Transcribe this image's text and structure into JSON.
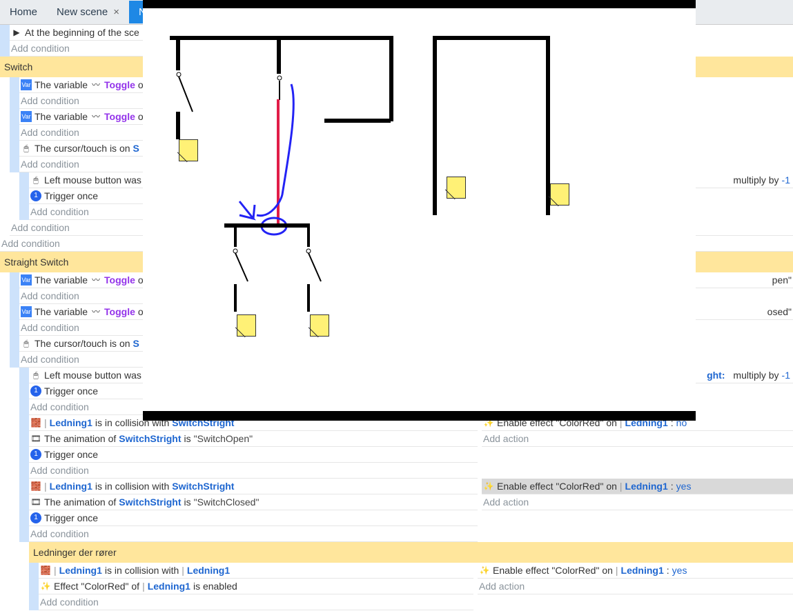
{
  "tabs": {
    "home": "Home",
    "scene1": "New scene",
    "scene2": "New"
  },
  "strs": {
    "begin_scene": "At the beginning of the sce",
    "add_condition": "Add condition",
    "add_action": "Add action",
    "switch_group": "Switch",
    "straight_switch_group": "Straight Switch",
    "ledninger_group": "Ledninger der rører",
    "the_variable": "The variable ",
    "toggle": "Toggle",
    "of_trunc": " of ",
    "cursor_on": "The cursor/touch is on ",
    "cursor_tail_s": "S",
    "lmb_released": "Left mouse button was",
    "trigger_once": "Trigger once",
    "collision_prefix": " is in collision with ",
    "ledning1": "Ledning1",
    "switchstright": "SwitchStright",
    "animation_of": "The animation of ",
    "is_q": " is ",
    "anim_open": "\"SwitchOpen\"",
    "anim_closed": "\"SwitchClosed\"",
    "effect_colorred_of": "Effect \"ColorRed\" of ",
    "is_enabled": " is enabled",
    "multiply_by": "multiply by ",
    "minus1": "-1",
    "ght": "ght:",
    "of_label": ": ",
    "enable_effect": "Enable effect \"ColorRed\" on ",
    "yes": "yes",
    "no": "no",
    "pen_q": "pen\"",
    "osed_q": "osed\""
  }
}
